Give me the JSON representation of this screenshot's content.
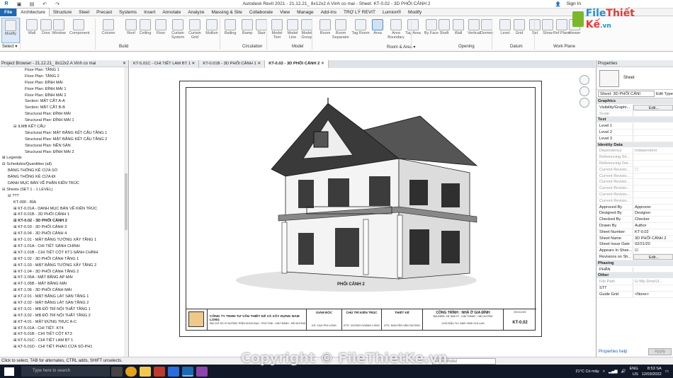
{
  "titlebar": {
    "title": "Autodesk Revit 2021 - 21.12.21_ 8x12x2 A Vinh co mai - Sheet: KT-0.02 - 3D PHỐI CẢNH 2",
    "sign_in": "Sign In"
  },
  "menu": {
    "file": "File",
    "items": [
      "Architecture",
      "Structure",
      "Steel",
      "Precast",
      "Systems",
      "Insert",
      "Annotate",
      "Analyze",
      "Massing & Site",
      "Collaborate",
      "View",
      "Manage",
      "Add-Ins",
      "TRỢ LÝ REVIT",
      "Lumion®",
      "Modify"
    ],
    "active": "Architecture"
  },
  "ribbon": {
    "buttons": [
      "Modify",
      "Wall",
      "Door",
      "Window",
      "Component",
      "Column",
      "Roof",
      "Ceiling",
      "Floor",
      "Curtain System",
      "Curtain Grid",
      "Mullion",
      "Railing",
      "Ramp",
      "Stair",
      "Model Text",
      "Model Line",
      "Model Group",
      "Room",
      "Room Separator",
      "Tag Room",
      "Area",
      "Area Boundary",
      "Tag Area",
      "By Face",
      "Shaft",
      "Wall",
      "Vertical",
      "Dormer",
      "Level",
      "Grid",
      "Set",
      "Show",
      "Ref Plane",
      "Viewer"
    ],
    "groups": [
      "Select ▾",
      "Build",
      "Circulation",
      "Model",
      "Room & Area ▾",
      "Opening",
      "Datum",
      "Work Plane"
    ]
  },
  "logo": {
    "text1": "File",
    "text2": "Thiết Kế",
    "text3": ".vn"
  },
  "browser": {
    "title": "Project Browser - 21.12.21_ 8x12x2 A Vinh co mai",
    "rows": [
      {
        "t": "Floor Plan: TẦNG 1",
        "l": 4
      },
      {
        "t": "Floor Plan: TẦNG 2",
        "l": 4
      },
      {
        "t": "Floor Plan: ĐỈNH MÁI",
        "l": 4
      },
      {
        "t": "Floor Plan: ĐỈNH MÁI 1",
        "l": 4
      },
      {
        "t": "Floor Plan: ĐỈNH MÁI 2",
        "l": 4
      },
      {
        "t": "Section: MẶT CẮT A-A",
        "l": 4
      },
      {
        "t": "Section: MẶT CẮT B-B",
        "l": 4
      },
      {
        "t": "Structural Plan: ĐỈNH MÁI",
        "l": 4
      },
      {
        "t": "Structural Plan: ĐỈNH MÁI 1",
        "l": 4
      },
      {
        "t": "⊟ ILMB KẾT CẤU",
        "l": 2
      },
      {
        "t": "Structural Plan: MẶT BẰNG KẾT CẤU TẦNG 1",
        "l": 4
      },
      {
        "t": "Structural Plan: MẶT BẰNG KẾT CẤU TẦNG 2",
        "l": 4
      },
      {
        "t": "Structural Plan: NỀN SÀN",
        "l": 4
      },
      {
        "t": "Structural Plan: ĐỈNH MÁI 2",
        "l": 4
      },
      {
        "t": "⊞ Legends",
        "l": 0
      },
      {
        "t": "⊟ Schedules/Quantities (all)",
        "l": 0
      },
      {
        "t": "BẢNG THỐNG KÊ CỬA SỔ",
        "l": 1
      },
      {
        "t": "BẢNG THỐNG KÊ CỬA ĐI",
        "l": 1
      },
      {
        "t": "DANH MỤC BẢN VẼ PHẦN KIẾN TRÚC",
        "l": 1
      },
      {
        "t": "⊟ Sheets (SET 1 - 1 LEVEL)",
        "l": 0
      },
      {
        "t": "⊟ ???",
        "l": 1
      },
      {
        "t": "KT-000 - BÌA",
        "l": 2
      },
      {
        "t": "⊞ KT-0.01A - DANH MỤC BẢN VẼ KIẾN TRÚC",
        "l": 2
      },
      {
        "t": "⊞ KT-0.01B - 3D PHỐI CẢNH 1",
        "l": 2
      },
      {
        "t": "⊞ KT-0.02 - 3D PHỐI CẢNH 2",
        "l": 2,
        "sel": true
      },
      {
        "t": "⊞ KT-0.03 - 3D PHỐI CẢNH 3",
        "l": 2
      },
      {
        "t": "⊞ KT-0.04 - 3D PHỐI CẢNH 4",
        "l": 2
      },
      {
        "t": "⊞ KT-1.01 - MẶT BẰNG TƯỜNG XÂY TẦNG 1",
        "l": 2
      },
      {
        "t": "⊞ KT-1.01A - CHI TIẾT SẢNH CHÍNH",
        "l": 2
      },
      {
        "t": "⊞ KT-1.01B - CHI TIẾT CỘT KT1-SẢNH CHÍNH",
        "l": 2
      },
      {
        "t": "⊞ KT-1.02 - 3D PHỐI CẢNH TẦNG 1",
        "l": 2
      },
      {
        "t": "⊞ KT-1.03 - MẶT BẰNG TƯỜNG XÂY TẦNG 2",
        "l": 2
      },
      {
        "t": "⊞ KT-1.04 - 3D PHỐI CẢNH TẦNG 2",
        "l": 2
      },
      {
        "t": "⊞ KT-1.05A - MẶT BẰNG ÁP MÁI",
        "l": 2
      },
      {
        "t": "⊞ KT-1.05B - MẶT BẰNG MÁI",
        "l": 2
      },
      {
        "t": "⊞ KT-1.06 - 3D PHỐI CẢNH MÁI",
        "l": 2
      },
      {
        "t": "⊞ KT-2.01 - MẶT BẰNG LÁT SÀN TẦNG 1",
        "l": 2
      },
      {
        "t": "⊞ KT-2.02 - MẶT BẰNG LÁT SÀN TẦNG 2",
        "l": 2
      },
      {
        "t": "⊞ KT-3.01 - MB ĐỒ TRÍ NỘI THẤT TẦNG 1",
        "l": 2
      },
      {
        "t": "⊞ KT-3.02 - MB ĐỒ TRÍ NỘI THẤT TẦNG 2",
        "l": 2
      },
      {
        "t": "⊞ KT-4.01 - MẶT ĐỨNG TRỤC A-C",
        "l": 2
      },
      {
        "t": "⊞ KT-5.01A - CHI TIẾT- KT4",
        "l": 2
      },
      {
        "t": "⊞ KT-5.01B - CHI TIẾT CỘT KT3",
        "l": 2
      },
      {
        "t": "⊞ KT-5.01C - CHI TIẾT LAM BT 1",
        "l": 2
      },
      {
        "t": "⊞ KT-5.01D - CHI TIẾT PHÀO CỬA SỔ-PH1",
        "l": 2
      }
    ]
  },
  "tabs": [
    {
      "label": "KT-5.01C - CHI TIẾT LAM BT 1",
      "active": false
    },
    {
      "label": "KT-0.01B - 3D PHỐI CẢNH 1",
      "active": false
    },
    {
      "label": "KT-0.02 - 3D PHỐI CẢNH 2",
      "active": true
    }
  ],
  "sheet": {
    "view_label": "PHỐI CẢNH 2",
    "company": "CÔNG TY TNHH TƯ VẤN THIẾT KẾ VÀ XÂY DỰNG NAM LONG",
    "company_addr": "ĐỊA CHỈ: SỐ 47 ĐƯỜNG TRẦN HƯNG ĐẠO - PHÚ THÁI - KIM THÀNH - HẢI DƯƠNG",
    "giam_doc": "GIÁM ĐỐC",
    "giam_doc_name": "KS. CAO PHI LONG",
    "chu_tri": "CHỦ TRÌ KIẾN TRÚC",
    "chu_tri_name": "KTS. VƯƠNG HOÀNG LONG",
    "thiet_ke": "THIẾT KẾ",
    "thiet_ke_name": "KTS. NGUYỄN VĂN DƯƠNG",
    "cong_trinh": "CÔNG TRÌNH : NHÀ Ở GIA ĐÌNH",
    "dia_diem": "ĐỊA ĐIỂM: XÃ TAM KỲ - KIM THÀNH - HẢI DƯƠNG",
    "chu_dau_tu": "CHỦ ĐẦU TƯ: ANH VINH CHỊ LAN",
    "sheet_no": "KT-0.02",
    "date": "2021/12/21"
  },
  "properties": {
    "title": "Properties",
    "type_name": "Sheet",
    "selector": "Sheet: 3D PHỐI CẢNI",
    "edit_type": "Edit Type",
    "sections": [
      {
        "name": "Graphics",
        "rows": [
          {
            "k": "Visibility/Graphi...",
            "v": "Edit...",
            "btn": true
          },
          {
            "k": "Scale",
            "v": "",
            "dim": true
          }
        ]
      },
      {
        "name": "Text",
        "rows": [
          {
            "k": "Level 1",
            "v": ""
          },
          {
            "k": "Level 2",
            "v": ""
          },
          {
            "k": "Level 3",
            "v": ""
          }
        ]
      },
      {
        "name": "Identity Data",
        "rows": [
          {
            "k": "Dependency",
            "v": "Independent",
            "dim": true
          },
          {
            "k": "Referencing Sh...",
            "v": "",
            "dim": true
          },
          {
            "k": "Referencing Det...",
            "v": "",
            "dim": true
          },
          {
            "k": "Current Revisio...",
            "v": "☐",
            "dim": true
          },
          {
            "k": "Current Revisio...",
            "v": "",
            "dim": true
          },
          {
            "k": "Current Revisio...",
            "v": "",
            "dim": true
          },
          {
            "k": "Current Revisio...",
            "v": "",
            "dim": true
          },
          {
            "k": "Current Revisio...",
            "v": "",
            "dim": true
          },
          {
            "k": "Current Revisio...",
            "v": "",
            "dim": true
          },
          {
            "k": "Approved By",
            "v": "Approver"
          },
          {
            "k": "Designed By",
            "v": "Designer"
          },
          {
            "k": "Checked By",
            "v": "Checker"
          },
          {
            "k": "Drawn By",
            "v": "Author"
          },
          {
            "k": "Sheet Number",
            "v": "KT-0.02"
          },
          {
            "k": "Sheet Name",
            "v": "3D PHỐI CẢNH 2"
          },
          {
            "k": "Sheet Issue Date",
            "v": "02/21/20"
          },
          {
            "k": "Appears In Shee...",
            "v": "☑"
          },
          {
            "k": "Revisions on Sh...",
            "v": "Edit...",
            "btn": true
          }
        ]
      },
      {
        "name": "Phasing",
        "rows": [
          {
            "k": "PHÂN",
            "v": ""
          }
        ]
      },
      {
        "name": "Other",
        "rows": [
          {
            "k": "File Path",
            "v": "G:\\My Drive\\3...",
            "dim": true
          },
          {
            "k": "STT",
            "v": ""
          },
          {
            "k": "Guide Grid",
            "v": "<None>"
          }
        ]
      }
    ],
    "help": "Properties help",
    "apply": "Apply"
  },
  "status": {
    "hint": "Click to select, TAB for alternates, CTRL adds, SHIFT unselects.",
    "model": "Main Model"
  },
  "taskbar": {
    "search": "Type here to search",
    "weather": "21°C Có mây",
    "lang": "ENG",
    "region": "US",
    "time": "8:53 SA",
    "date": "12/03/2022"
  },
  "watermark": "Copyright © FileThietKe.vn"
}
